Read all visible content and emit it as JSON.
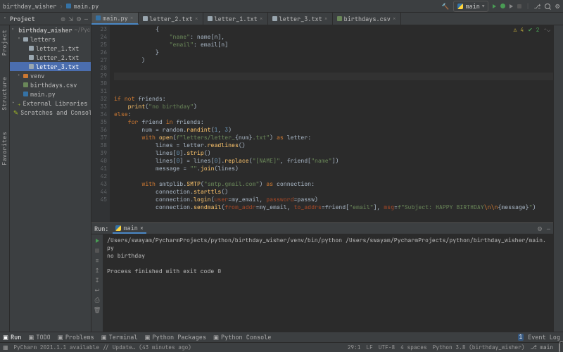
{
  "nav": {
    "breadcrumb": [
      "birthday_wisher",
      "main.py"
    ],
    "run_config": "main"
  },
  "project_toolbar": {
    "label": "Project"
  },
  "tabs": [
    {
      "name": "main.py",
      "kind": "py",
      "active": true
    },
    {
      "name": "letter_2.txt",
      "kind": "txt",
      "active": false
    },
    {
      "name": "letter_1.txt",
      "kind": "txt",
      "active": false
    },
    {
      "name": "letter_3.txt",
      "kind": "txt",
      "active": false
    },
    {
      "name": "birthdays.csv",
      "kind": "csv",
      "active": false
    }
  ],
  "tree": {
    "root": {
      "name": "birthday_wisher",
      "hint": "~/PycharmProjects/py"
    },
    "items": [
      {
        "name": "letters",
        "kind": "folder",
        "open": true,
        "children": [
          {
            "name": "letter_1.txt",
            "kind": "txt"
          },
          {
            "name": "letter_2.txt",
            "kind": "txt"
          },
          {
            "name": "letter_3.txt",
            "kind": "txt",
            "selected": true
          }
        ]
      },
      {
        "name": "venv",
        "kind": "folder-excl"
      },
      {
        "name": "birthdays.csv",
        "kind": "csv"
      },
      {
        "name": "main.py",
        "kind": "py"
      }
    ],
    "external": "External Libraries",
    "scratches": "Scratches and Consoles"
  },
  "side_labels": {
    "project": "Project",
    "structure": "Structure",
    "favorites": "Favorites"
  },
  "editor": {
    "first_line_no": 23,
    "inspections": {
      "warn": "4",
      "ok": "2"
    },
    "lines": [
      "            {",
      "                <span class='str'>\"name\"</span>: name[n],",
      "                <span class='str'>\"email\"</span>: email[n]",
      "            }",
      "        )",
      "",
      "<span class='caret-line'> </span>",
      "",
      "<span class='kw'>if not </span>friends:",
      "    <span class='fn'>print</span>(<span class='str'>\"no birthday\"</span>)",
      "<span class='kw'>else</span>:",
      "    <span class='kw'>for </span>friend <span class='kw'>in </span>friends:",
      "        num = random.<span class='fn'>randint</span>(<span class='num'>1</span>, <span class='num'>3</span>)",
      "        <span class='kw'>with </span><span class='fn'>open</span>(<span class='str'>f\"letters/letter_</span>{num}<span class='str'>.txt\"</span>) <span class='kw'>as </span>letter:",
      "            lines = letter.<span class='fn'>readlines</span>()",
      "            lines[<span class='num'>0</span>].<span class='fn'>strip</span>()",
      "            lines[<span class='num'>0</span>] = lines[<span class='num'>0</span>].<span class='fn'>replace</span>(<span class='str'>\"[NAME]\"</span>, friend[<span class='str'>\"name\"</span>])",
      "            message = <span class='str'>\"\"</span>.<span class='fn'>join</span>(lines)",
      "",
      "        <span class='kw'>with </span>smtplib.<span class='fn'>SMTP</span>(<span class='str'>\"smtp.gmail.com\"</span>) <span class='kw'>as </span>connection:",
      "            connection.<span class='fn'>starttls</span>()",
      "            connection.<span class='fn'>login</span>(<span class='par'>user</span>=my_email, <span class='par'>password</span>=passw)",
      "            connection.<span class='fn'>sendmail</span>(<span class='par'>from_addr</span>=my_email, <span class='par'>to_addrs</span>=friend[<span class='str'>\"email\"</span>], <span class='par'>msg</span>=<span class='str'>f\"Subject: HAPPY BIRTHDAY</span><span class='esc'>\\n\\n</span>{message}<span class='str'>\"</span>)"
    ]
  },
  "run": {
    "title": "Run:",
    "tab": "main",
    "output": [
      "/Users/swayam/PycharmProjects/python/birthday_wisher/venv/bin/python /Users/swayam/PycharmProjects/python/birthday_wisher/main.py",
      "no birthday",
      "",
      "Process finished with exit code 0"
    ]
  },
  "bottom": {
    "tools": [
      {
        "label": "Run",
        "selected": true
      },
      {
        "label": "TODO"
      },
      {
        "label": "Problems"
      },
      {
        "label": "Terminal"
      },
      {
        "label": "Python Packages"
      },
      {
        "label": "Python Console"
      }
    ],
    "event_log": {
      "count": "1",
      "label": "Event Log"
    }
  },
  "status": {
    "left": "PyCharm 2021.1.1 available // Update… (43 minutes ago)",
    "pos": "29:1",
    "sep": "LF",
    "enc": "UTF-8",
    "indent": "4 spaces",
    "interp": "Python 3.8 (birthday_wisher)",
    "branch": "main"
  }
}
